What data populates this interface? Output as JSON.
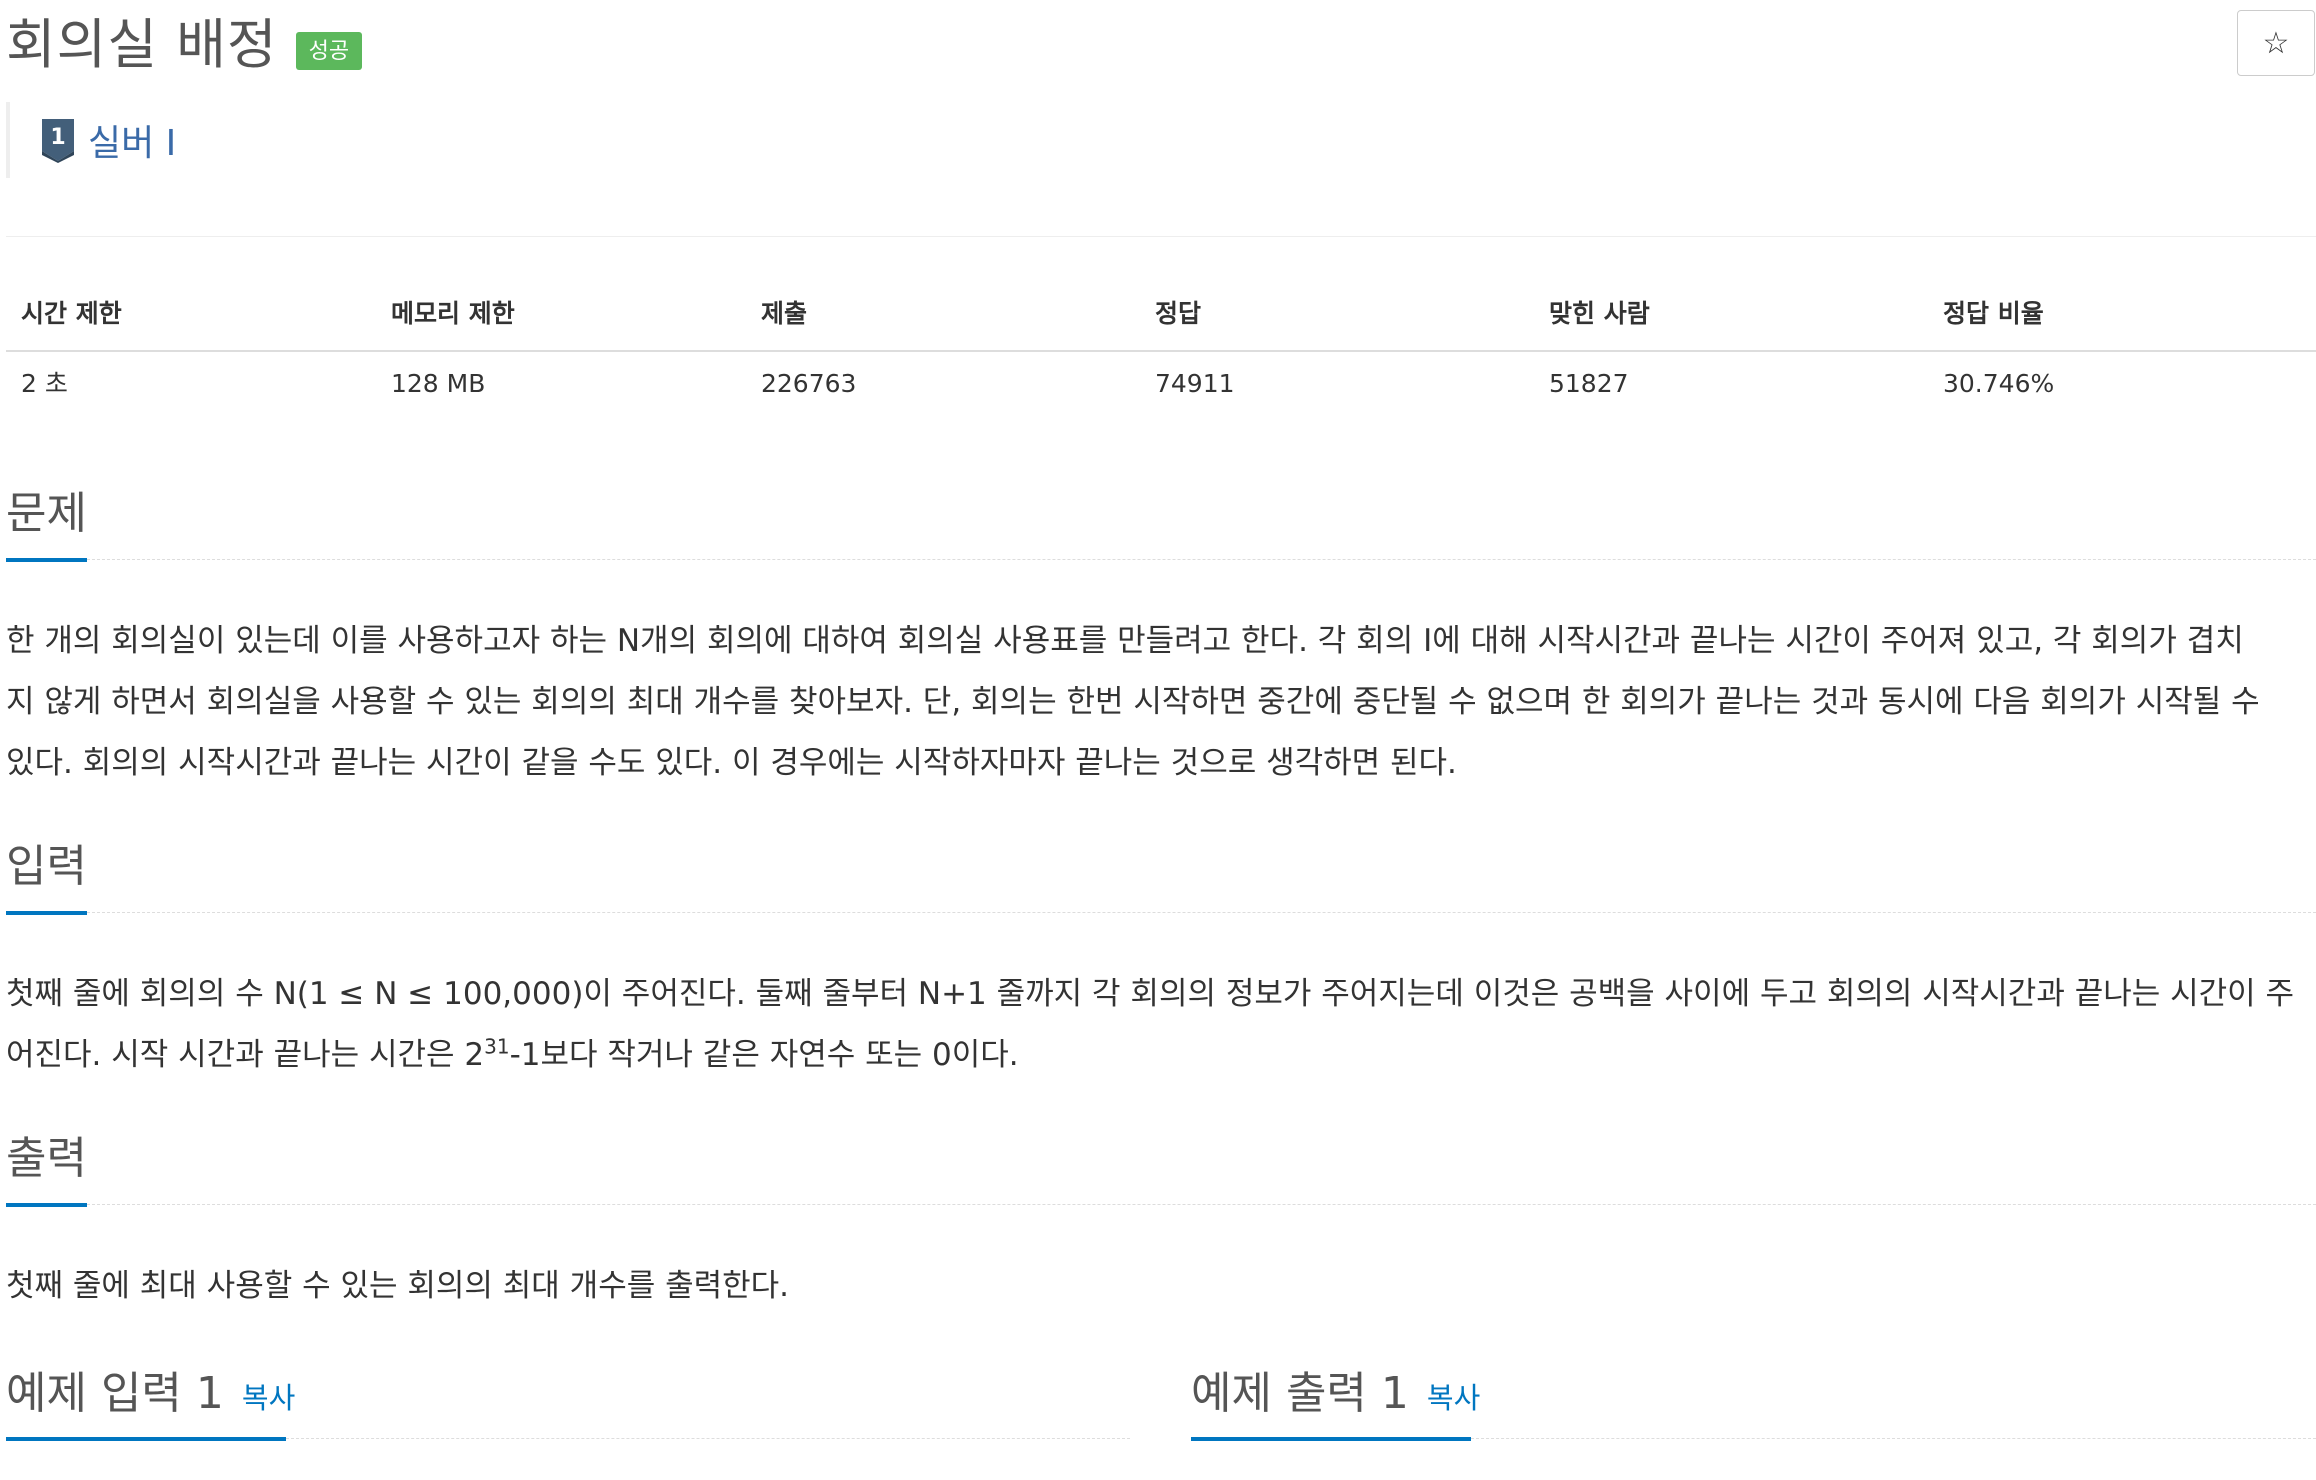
{
  "problem": {
    "title": "회의실 배정",
    "result_badge": "성공",
    "star_icon": "☆",
    "tier": {
      "number": "1",
      "label": "실버 I"
    }
  },
  "info_table": {
    "headers": [
      "시간 제한",
      "메모리 제한",
      "제출",
      "정답",
      "맞힌 사람",
      "정답 비율"
    ],
    "values": [
      "2 초",
      "128 MB",
      "226763",
      "74911",
      "51827",
      "30.746%"
    ]
  },
  "sections": {
    "description": {
      "title": "문제",
      "lines": [
        "한 개의 회의실이 있는데 이를 사용하고자 하는 N개의 회의에 대하여 회의실 사용표를 만들려고 한다. 각 회의 I에 대해 시작시간과 끝나는 시간이 주어져 있고, 각 회의가 겹치",
        "지 않게 하면서 회의실을 사용할 수 있는 회의의 최대 개수를 찾아보자. 단, 회의는 한번 시작하면 중간에 중단될 수 없으며 한 회의가 끝나는 것과 동시에 다음 회의가 시작될 수",
        "있다. 회의의 시작시간과 끝나는 시간이 같을 수도 있다. 이 경우에는 시작하자마자 끝나는 것으로 생각하면 된다."
      ]
    },
    "input": {
      "title": "입력",
      "line1": "첫째 줄에 회의의 수 N(1 ≤ N ≤ 100,000)이 주어진다. 둘째 줄부터 N+1 줄까지 각 회의의 정보가 주어지는데 이것은 공백을 사이에 두고 회의의 시작시간과 끝나는 시간이 주",
      "line2_before": "어진다. 시작 시간과 끝나는 시간은 2",
      "line2_sup": "31",
      "line2_after": "-1보다 작거나 같은 자연수 또는 0이다."
    },
    "output": {
      "title": "출력",
      "text": "첫째 줄에 최대 사용할 수 있는 회의의 최대 개수를 출력한다."
    },
    "sample_input": {
      "title": "예제 입력 1",
      "copy_label": "복사"
    },
    "sample_output": {
      "title": "예제 출력 1",
      "copy_label": "복사"
    }
  },
  "colors": {
    "accent": "#0076c0",
    "success": "#5cb85c",
    "tier_silver": "#435f7a"
  }
}
